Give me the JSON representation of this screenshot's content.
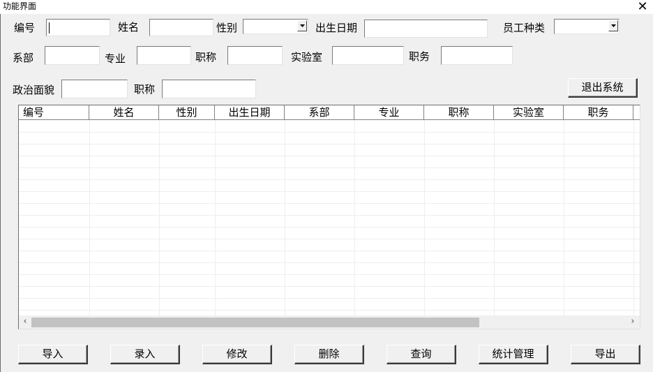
{
  "window": {
    "title": "功能界面",
    "close_glyph": "✕"
  },
  "form": {
    "labels": {
      "id": "编号",
      "name": "姓名",
      "gender": "性别",
      "birth_date": "出生日期",
      "staff_type": "员工种类",
      "department": "系部",
      "major": "专业",
      "title1": "职称",
      "lab": "实验室",
      "position": "职务",
      "political_status": "政治面貌",
      "title2": "职称"
    },
    "values": {
      "id": "",
      "name": "",
      "gender": "",
      "birth_date": "",
      "staff_type": "",
      "department": "",
      "major": "",
      "title1": "",
      "lab": "",
      "position": "",
      "political_status": "",
      "title2": ""
    }
  },
  "buttons": {
    "exit": "退出系统",
    "import": "导入",
    "enter": "录入",
    "modify": "修改",
    "delete": "删除",
    "query": "查询",
    "stats": "统计管理",
    "export": "导出"
  },
  "grid": {
    "columns": [
      "编号",
      "姓名",
      "性别",
      "出生日期",
      "系部",
      "专业",
      "职称",
      "实验室",
      "职务"
    ],
    "rows": []
  },
  "scrollbar": {
    "left_arrow": "‹",
    "right_arrow": "›"
  }
}
